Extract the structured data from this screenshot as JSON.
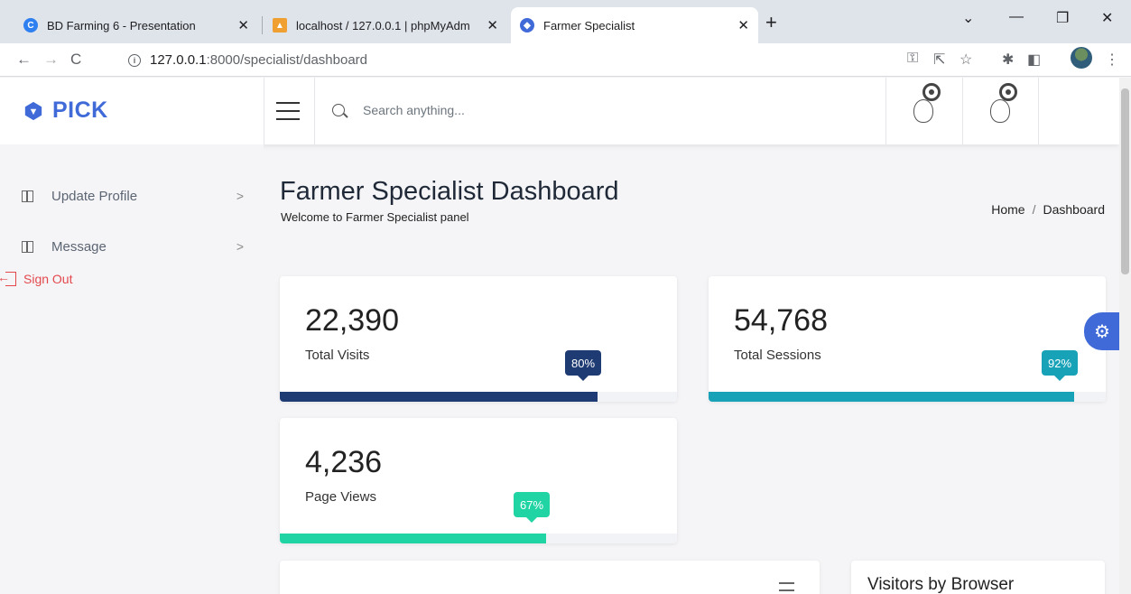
{
  "browser": {
    "tabs": [
      {
        "title": "BD Farming 6 - Presentation",
        "close": "✕",
        "active": false
      },
      {
        "title": "localhost / 127.0.0.1 | phpMyAdm",
        "close": "✕",
        "active": false
      },
      {
        "title": "Farmer Specialist",
        "close": "✕",
        "active": true
      }
    ],
    "new_tab": "+",
    "url_host": "127.0.0.1",
    "url_rest": ":8000/specialist/dashboard"
  },
  "header": {
    "logo_text": "PICK",
    "search_placeholder": "Search anything..."
  },
  "sidebar": {
    "items": [
      {
        "label": "Update Profile"
      },
      {
        "label": "Message"
      }
    ],
    "signout_label": "Sign Out"
  },
  "page": {
    "title": "Farmer Specialist Dashboard",
    "subtitle": "Welcome to Farmer Specialist panel",
    "breadcrumb": [
      "Home",
      "Dashboard"
    ]
  },
  "stats": [
    {
      "value": "22,390",
      "label": "Total Visits",
      "percent": "80%",
      "fill": 0.8,
      "color": "#1f3b73"
    },
    {
      "value": "54,768",
      "label": "Total Sessions",
      "percent": "92%",
      "fill": 0.92,
      "color": "#17a2b8"
    },
    {
      "value": "4,236",
      "label": "Page Views",
      "percent": "67%",
      "fill": 0.67,
      "color": "#20d4a4"
    }
  ],
  "panels": {
    "browser_title": "Visitors by Browser"
  },
  "colors": {
    "brand": "#3f6ad8",
    "danger": "#e3484d"
  }
}
